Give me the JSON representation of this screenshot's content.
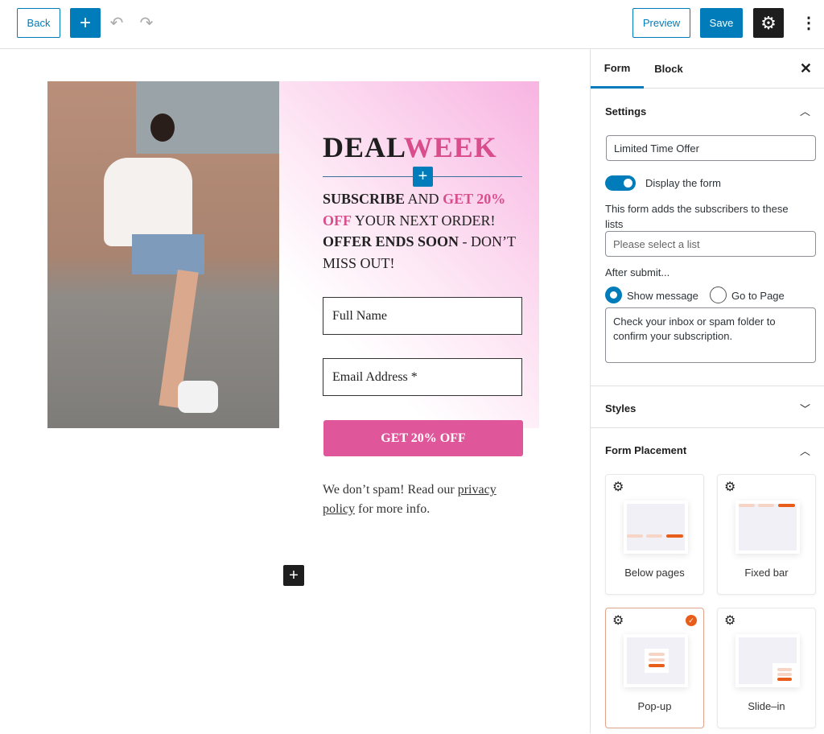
{
  "toolbar": {
    "back": "Back",
    "add": "+",
    "preview": "Preview",
    "save": "Save"
  },
  "form": {
    "headline_dark": "DEAL",
    "headline_pink": "WEEK",
    "line1_bold": "SUBSCRIBE",
    "line1_mid": " AND ",
    "line1_pink": "GET 20%",
    "line2_pink": "OFF",
    "line2_rest": " YOUR NEXT ORDER!",
    "line3_bold": "OFFER ENDS SOON",
    "line3_rest": " - DON’T",
    "line4": "MISS OUT!",
    "full_name": "Full Name",
    "email": "Email Address *",
    "submit": "GET 20% OFF",
    "footer_pre": "We don’t spam! Read our ",
    "footer_link1": "privacy ",
    "footer_link2": "policy",
    "footer_post": " for more info."
  },
  "sidebar": {
    "tabs": [
      "Form",
      "Block"
    ],
    "settings_title": "Settings",
    "form_name": "Limited Time Offer",
    "display_label": "Display the form",
    "display_on": true,
    "lists_desc": "This form adds the subscribers to these lists",
    "lists_placeholder": "Please select a list",
    "after_submit": "After submit...",
    "radio_show": "Show message",
    "radio_page": "Go to Page",
    "message": "Check your inbox or spam folder to confirm your subscription.",
    "styles_title": "Styles",
    "placement_title": "Form Placement",
    "placements": [
      "Below pages",
      "Fixed bar",
      "Pop-up",
      "Slide–in"
    ],
    "selected_placement": "Pop-up",
    "accent": "#e85d1a"
  }
}
